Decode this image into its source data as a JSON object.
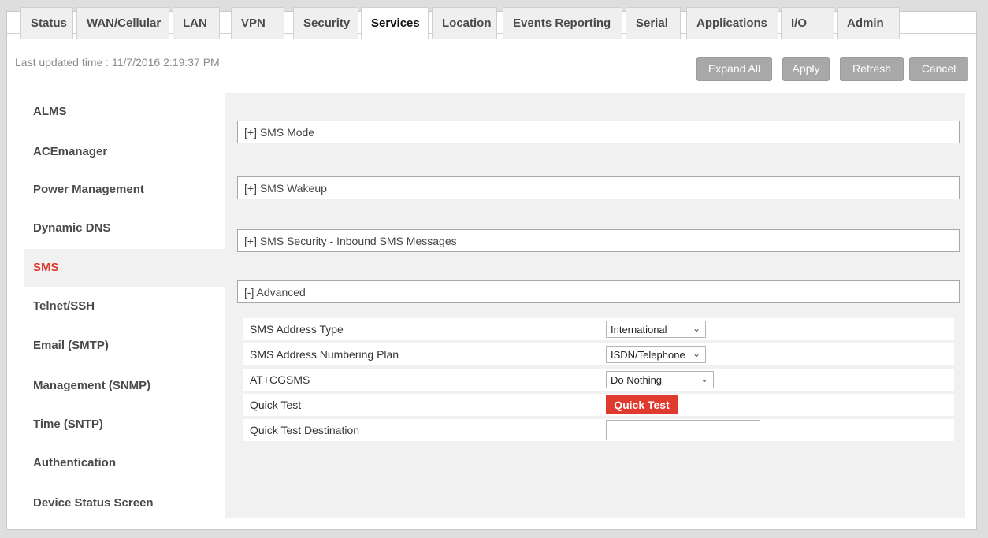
{
  "tabs": [
    {
      "label": "Status"
    },
    {
      "label": "WAN/Cellular"
    },
    {
      "label": "LAN"
    },
    {
      "label": "VPN"
    },
    {
      "label": "Security"
    },
    {
      "label": "Services"
    },
    {
      "label": "Location"
    },
    {
      "label": "Events Reporting"
    },
    {
      "label": "Serial"
    },
    {
      "label": "Applications"
    },
    {
      "label": "I/O"
    },
    {
      "label": "Admin"
    }
  ],
  "active_tab": "Services",
  "last_updated": "Last updated time : 11/7/2016 2:19:37 PM",
  "toolbar": {
    "expand_all": "Expand All",
    "apply": "Apply",
    "refresh": "Refresh",
    "cancel": "Cancel"
  },
  "sidebar": {
    "items": [
      {
        "label": "ALMS"
      },
      {
        "label": "ACEmanager"
      },
      {
        "label": "Power Management"
      },
      {
        "label": "Dynamic DNS"
      },
      {
        "label": "SMS"
      },
      {
        "label": "Telnet/SSH"
      },
      {
        "label": "Email (SMTP)"
      },
      {
        "label": "Management (SNMP)"
      },
      {
        "label": "Time (SNTP)"
      },
      {
        "label": "Authentication"
      },
      {
        "label": "Device Status Screen"
      }
    ],
    "active": "SMS"
  },
  "sections": [
    {
      "label": "[+] SMS Mode"
    },
    {
      "label": "[+] SMS Wakeup"
    },
    {
      "label": "[+] SMS Security - Inbound SMS Messages"
    },
    {
      "label": "[-] Advanced"
    }
  ],
  "advanced": {
    "rows": [
      {
        "label": "SMS Address Type",
        "value": "International"
      },
      {
        "label": "SMS Address Numbering Plan",
        "value": "ISDN/Telephone"
      },
      {
        "label": "AT+CGSMS",
        "value": "Do Nothing"
      },
      {
        "label": "Quick Test",
        "value": "Quick Test"
      },
      {
        "label": "Quick Test Destination",
        "value": ""
      }
    ]
  },
  "colors": {
    "accent": "#e03a2f",
    "button_gray": "#a8a8a8",
    "panel_bg": "#f1f1f1"
  }
}
